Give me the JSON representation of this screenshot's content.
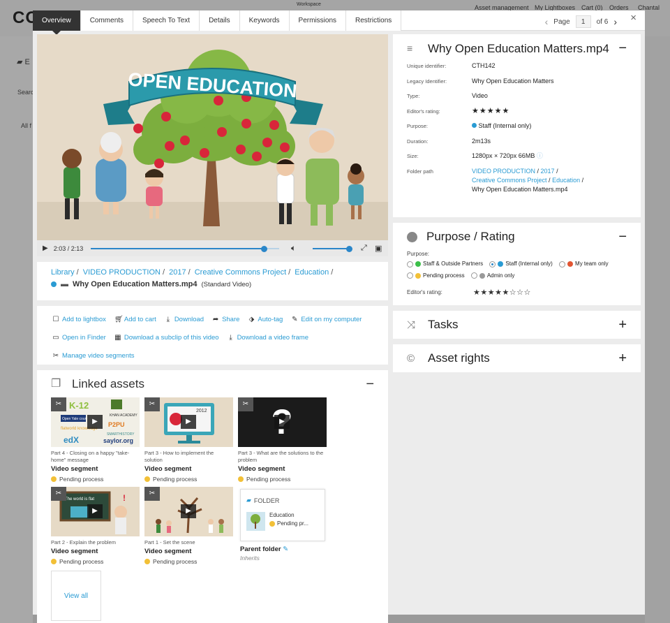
{
  "background": {
    "logo": "CO",
    "nav": [
      "Asset management",
      "My Lightboxes",
      "Cart (0)",
      "Orders",
      "Chantal"
    ],
    "workspace_label": "Workspace",
    "side_rows": [
      "E",
      "Searc",
      "All f"
    ]
  },
  "tabs": [
    "Overview",
    "Comments",
    "Speech To Text",
    "Details",
    "Keywords",
    "Permissions",
    "Restrictions"
  ],
  "pager": {
    "label": "Page",
    "current": "1",
    "of": "of 6"
  },
  "video": {
    "banner": "OPEN EDUCATION",
    "time": "2:03 / 2:13",
    "progress": 0.92,
    "volume": 1.0
  },
  "breadcrumb": {
    "items": [
      "Library",
      "VIDEO PRODUCTION",
      "2017",
      "Creative Commons Project",
      "Education"
    ],
    "file_name": "Why Open Education Matters.mp4",
    "file_type": "(Standard Video)"
  },
  "actions": [
    [
      {
        "label": "Add to lightbox",
        "icon": "square-icon"
      },
      {
        "label": "Add to cart",
        "icon": "cart-icon"
      },
      {
        "label": "Download",
        "icon": "download-icon"
      },
      {
        "label": "Share",
        "icon": "share-icon"
      },
      {
        "label": "Auto-tag",
        "icon": "tag-icon"
      },
      {
        "label": "Edit on my computer",
        "icon": "pencil-icon"
      }
    ],
    [
      {
        "label": "Open in Finder",
        "icon": "monitor-icon"
      },
      {
        "label": "Download a subclip of this video",
        "icon": "film-icon"
      },
      {
        "label": "Download a video frame",
        "icon": "download-icon"
      }
    ],
    [
      {
        "label": "Manage video segments",
        "icon": "scissors-icon"
      }
    ]
  ],
  "linked": {
    "title": "Linked assets",
    "toggle": "−",
    "items": [
      {
        "caption": "Part 4 - Closing on a happy \"take-home\" message",
        "type": "Video segment",
        "status": "Pending process"
      },
      {
        "caption": "Part 3 - How to implement the solution",
        "type": "Video segment",
        "status": "Pending process"
      },
      {
        "caption": "Part 3 - What are the solutions to the problem",
        "type": "Video segment",
        "status": "Pending process"
      },
      {
        "caption": "Part 2 - Explain the problem",
        "type": "Video segment",
        "status": "Pending process"
      },
      {
        "caption": "Part 1 - Set the scene",
        "type": "Video segment",
        "status": "Pending process"
      }
    ],
    "thumb_text": {
      "k12": "K-12",
      "khan": "KHAN ACADEMY",
      "p2pu": "P2PU",
      "saylor": "saylor.org",
      "edx": "edX",
      "openyale": "Open Yale courses",
      "flatworld": "flatworld knowledge",
      "smarthistory": "SMARTHISTORY",
      "year": "2012",
      "question": "?",
      "world": "The world is flat",
      "bang": "!"
    },
    "folder": {
      "header": "FOLDER",
      "name": "Education",
      "status": "Pending pr...",
      "label": "Parent folder",
      "sub": "Inherits"
    },
    "view_all": "View all"
  },
  "info": {
    "title": "Why Open Education Matters.mp4",
    "toggle": "−",
    "rows": {
      "uid_k": "Unique identifier:",
      "uid_v": "CTH142",
      "legacy_k": "Legacy Identifier:",
      "legacy_v": "Why Open Education Matters",
      "type_k": "Type:",
      "type_v": "Video",
      "rating_k": "Editor's rating:",
      "rating_v": "★★★★★",
      "purpose_k": "Purpose:",
      "purpose_v": "Staff (Internal only)",
      "duration_k": "Duration:",
      "duration_v": "2m13s",
      "size_k": "Size:",
      "size_v": "1280px × 720px 66MB",
      "folder_k": "Folder path",
      "folder_links": [
        "VIDEO PRODUCTION",
        "2017",
        "Creative Commons Project",
        "Education"
      ],
      "folder_file": "Why Open Education Matters.mp4"
    }
  },
  "purpose": {
    "title": "Purpose / Rating",
    "toggle": "−",
    "label": "Purpose:",
    "options": [
      {
        "label": "Staff & Outside Partners",
        "color": "#3cbf4a",
        "selected": false
      },
      {
        "label": "Staff (Internal only)",
        "color": "#2a9bd3",
        "selected": true
      },
      {
        "label": "My team only",
        "color": "#e25532",
        "selected": false
      },
      {
        "label": "Pending process",
        "color": "#f2c037",
        "selected": false
      },
      {
        "label": "Admin only",
        "color": "#9a9a9a",
        "selected": false
      }
    ],
    "rating_label": "Editor's rating:",
    "rating_value": 5,
    "rating_max": 10
  },
  "tasks": {
    "title": "Tasks",
    "toggle": "+"
  },
  "rights": {
    "title": "Asset rights",
    "toggle": "+"
  },
  "colors": {
    "accent": "#2a9bd3",
    "pending": "#f2c037",
    "internal": "#2a9bd3"
  }
}
